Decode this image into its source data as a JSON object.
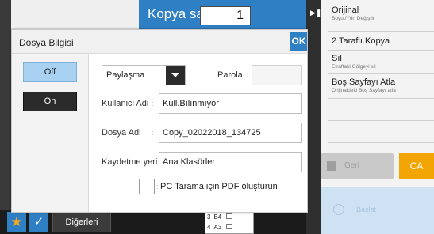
{
  "header": {
    "copy_label": "Kopya sayısı",
    "copy_count": "1"
  },
  "right_panel": {
    "items": [
      {
        "title": "Orijinal",
        "subtitle": "Boyut/Yön Değiştir"
      },
      {
        "title": "2 Taraflı.Kopya",
        "subtitle": ""
      },
      {
        "title": "Sıl",
        "subtitle": "Etraftaki Gölgeyi sil"
      },
      {
        "title": "Boş Sayfayı Atla",
        "subtitle": "Orijinaldeki Boş Sayfayı atla"
      }
    ],
    "clear_label": "Geri",
    "ca_label": "CA",
    "start_label": "Başlat"
  },
  "bottom": {
    "others_label": "Diğerleri",
    "tray_rows": [
      {
        "num": "3",
        "size": "B4"
      },
      {
        "num": "4",
        "size": "A3"
      }
    ]
  },
  "dialog": {
    "title": "Dosya Bilgisi",
    "ok_label": "OK",
    "off_label": "Off",
    "on_label": "On",
    "share_value": "Paylaşma",
    "password_label": "Parola",
    "username_label": "Kullanici Adi",
    "username_value": "Kull.Bılınmıyor",
    "filename_label": "Dosya Adi",
    "filename_value": "Copy_02022018_134725",
    "savelocation_label": "Kaydetme yeri",
    "savelocation_value": "Ana Klasörler",
    "pdf_label": "PC Tarama için PDF oluşturun"
  },
  "colors": {
    "accent": "#2f7fc4",
    "ca": "#f2a500",
    "off_selected": "#a9d2f2",
    "on_dark": "#2b2b2b"
  }
}
